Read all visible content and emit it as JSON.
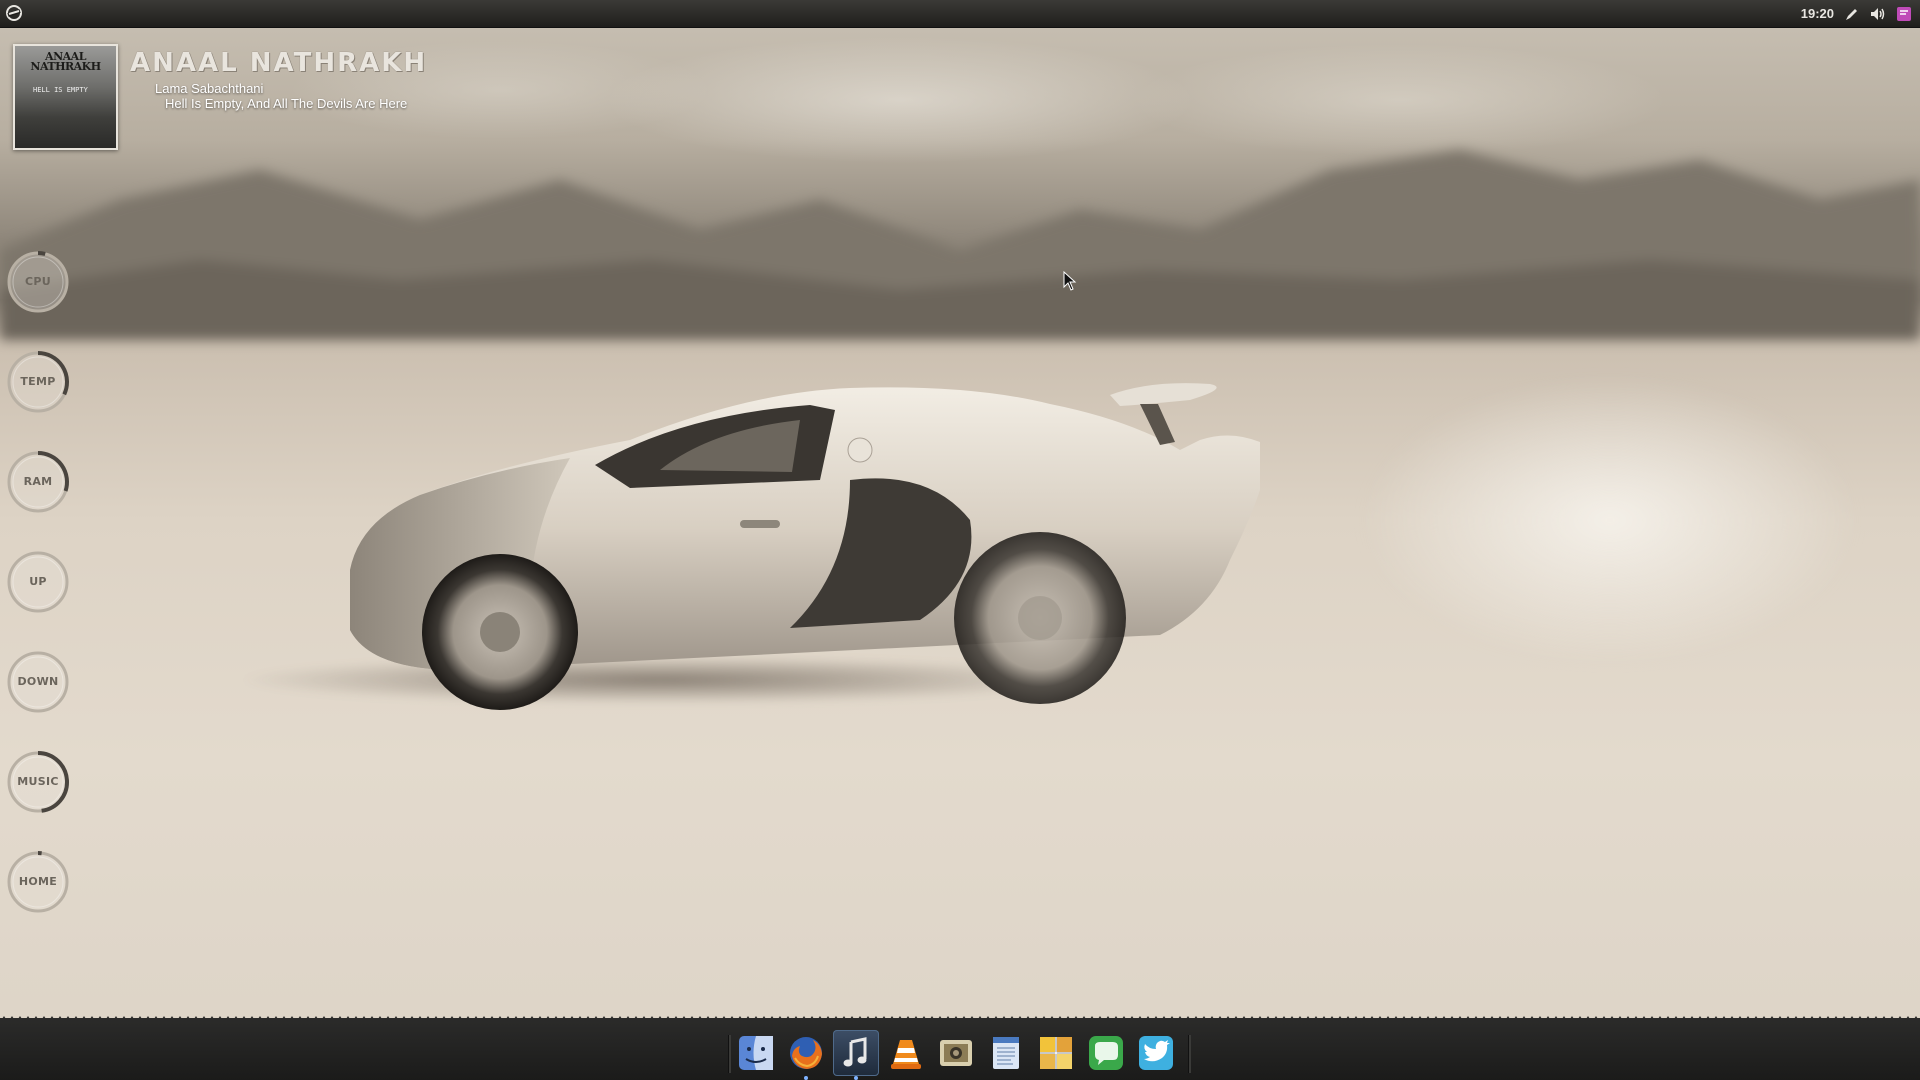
{
  "panel": {
    "clock": "19:20",
    "icons": [
      "distro-logo-icon",
      "pen-icon",
      "volume-icon",
      "notification-icon"
    ]
  },
  "now_playing": {
    "artist": "ANAAL NATHRAKH",
    "track": "Lama Sabachthani",
    "album": "Hell Is Empty, And All The Devils Are Here",
    "album_art_title": "ANAAL NATHRAKH",
    "album_art_subtitle": "HELL IS EMPTY"
  },
  "meters": [
    {
      "label": "CPU",
      "level": 0.04
    },
    {
      "label": "TEMP",
      "level": 0.32
    },
    {
      "label": "RAM",
      "level": 0.3
    },
    {
      "label": "UP",
      "level": 0.0
    },
    {
      "label": "DOWN",
      "level": 0.0
    },
    {
      "label": "MUSIC",
      "level": 0.48
    },
    {
      "label": "HOME",
      "level": 0.02
    }
  ],
  "dock": {
    "items": [
      {
        "name": "finder-icon",
        "running": false
      },
      {
        "name": "firefox-icon",
        "running": true
      },
      {
        "name": "music-player-icon",
        "running": true,
        "active": true
      },
      {
        "name": "vlc-icon",
        "running": false
      },
      {
        "name": "image-viewer-icon",
        "running": false
      },
      {
        "name": "text-editor-icon",
        "running": false
      },
      {
        "name": "photo-gallery-icon",
        "running": false
      },
      {
        "name": "chat-icon",
        "running": false
      },
      {
        "name": "twitter-icon",
        "running": false
      }
    ]
  },
  "colors": {
    "panel_bg": "#1f1e1c",
    "dock_bg": "#1b1b1a",
    "meter_track": "#b8b0a4",
    "meter_fill": "#4a453f",
    "active_dock_highlight": "#3d4e66"
  }
}
